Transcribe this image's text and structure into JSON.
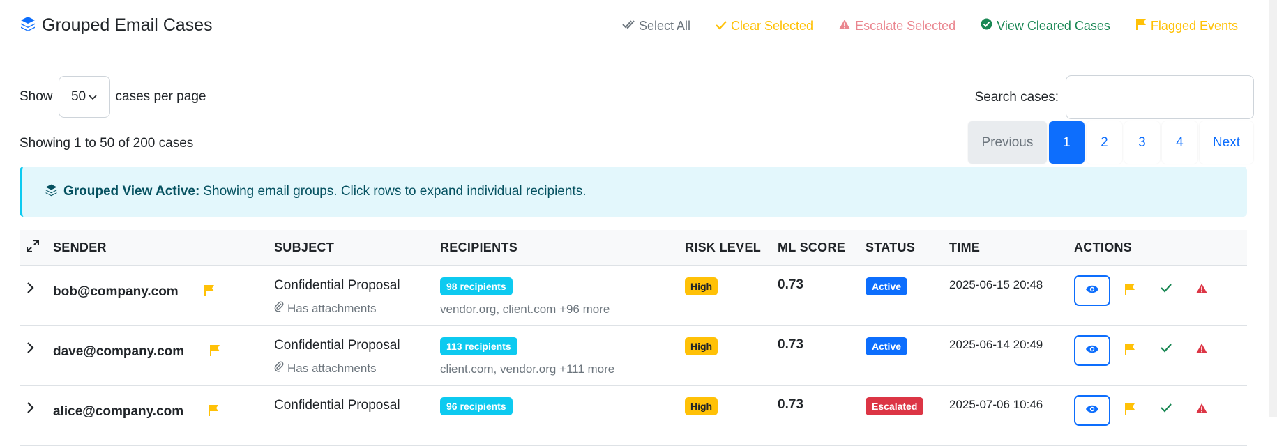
{
  "header": {
    "title": "Grouped Email Cases",
    "actions": {
      "select_all": "Select All",
      "clear_selected": "Clear Selected",
      "escalate_selected": "Escalate Selected",
      "view_cleared": "View Cleared Cases",
      "flagged_events": "Flagged Events"
    }
  },
  "controls": {
    "show_label": "Show",
    "per_page_value": "50",
    "per_page_suffix": "cases per page",
    "search_label": "Search cases:",
    "search_value": ""
  },
  "info": {
    "showing": "Showing 1 to 50 of 200 cases"
  },
  "pagination": {
    "previous": "Previous",
    "pages": [
      "1",
      "2",
      "3",
      "4"
    ],
    "active": "1",
    "next": "Next"
  },
  "alert": {
    "bold": "Grouped View Active:",
    "text": "Showing email groups. Click rows to expand individual recipients."
  },
  "table": {
    "columns": [
      "SENDER",
      "SUBJECT",
      "RECIPIENTS",
      "RISK LEVEL",
      "ML SCORE",
      "STATUS",
      "TIME",
      "ACTIONS"
    ],
    "rows": [
      {
        "sender": "bob@company.com",
        "subject": "Confidential Proposal",
        "attachment": "Has attachments",
        "recipients_badge": "98 recipients",
        "domains": "vendor.org, client.com +96 more",
        "risk": "High",
        "score": "0.73",
        "status": "Active",
        "time": "2025-06-15 20:48"
      },
      {
        "sender": "dave@company.com",
        "subject": "Confidential Proposal",
        "attachment": "Has attachments",
        "recipients_badge": "113 recipients",
        "domains": "client.com, vendor.org +111 more",
        "risk": "High",
        "score": "0.73",
        "status": "Active",
        "time": "2025-06-14 20:49"
      },
      {
        "sender": "alice@company.com",
        "subject": "Confidential Proposal",
        "attachment": "",
        "recipients_badge": "96 recipients",
        "domains": "",
        "risk": "High",
        "score": "0.73",
        "status": "Escalated",
        "time": "2025-07-06 10:46"
      }
    ]
  },
  "colors": {
    "primary": "#0d6efd",
    "info": "#0dcaf0",
    "warning": "#ffc107",
    "danger": "#dc3545",
    "success": "#198754"
  }
}
